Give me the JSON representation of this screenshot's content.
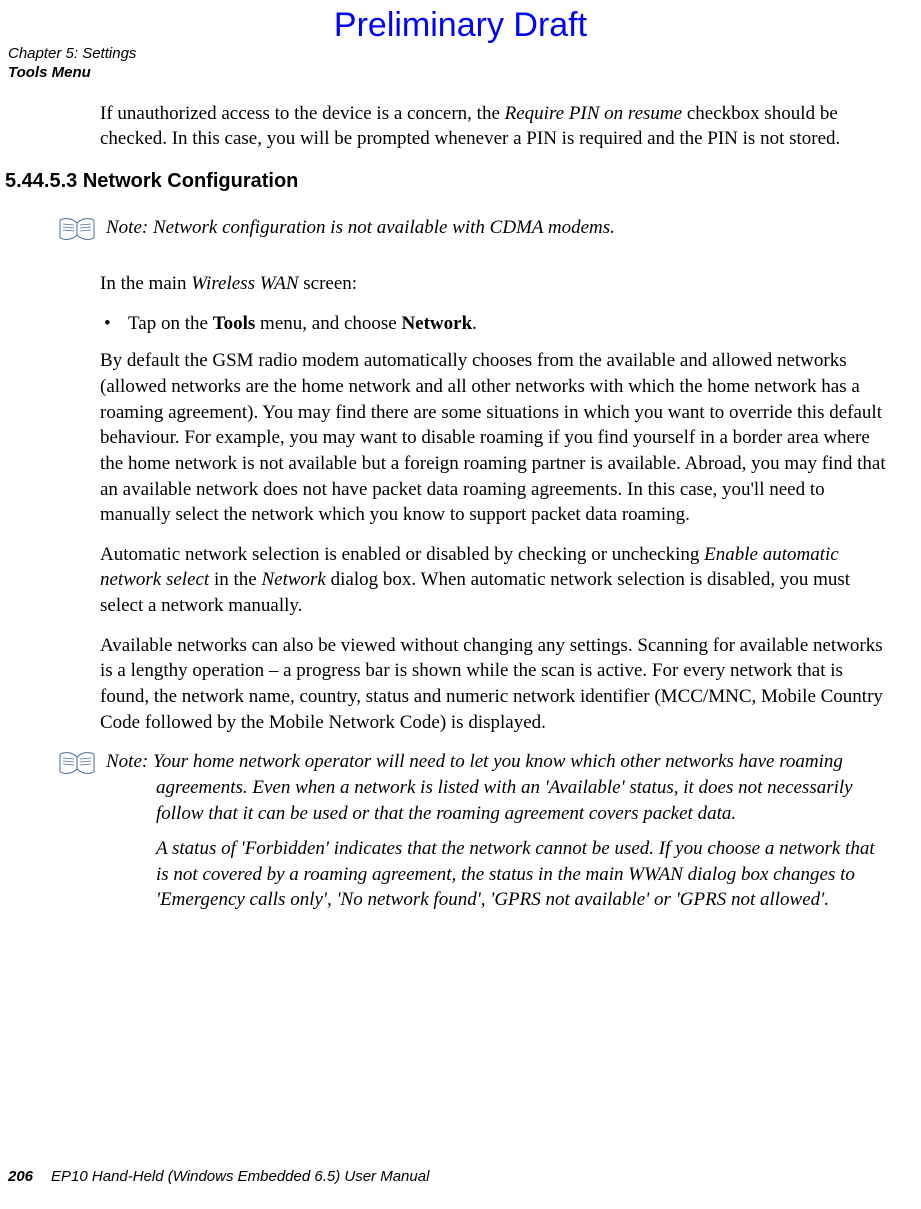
{
  "header": {
    "draft_banner": "Preliminary Draft",
    "chapter_line": "Chapter 5: Settings",
    "chapter_sub": "Tools Menu"
  },
  "body": {
    "intro_pre": "If unauthorized access to the device is a concern, the ",
    "intro_italic": "Require PIN on resume",
    "intro_post": " checkbox should be checked. In this case, you will be prompted whenever a PIN is required and the PIN is not stored.",
    "section_number": "5.44.5.3 ",
    "section_title": "Network Configuration",
    "note1": "Note: Network configuration is not available with CDMA modems.",
    "p2_pre": "In the main ",
    "p2_italic": "Wireless WAN",
    "p2_post": " screen:",
    "bullet_pre": "Tap on the ",
    "bullet_bold1": "Tools",
    "bullet_mid": " menu, and choose ",
    "bullet_bold2": "Network",
    "bullet_post": ".",
    "p3": "By default the GSM radio modem automatically chooses from the available and allowed networks (allowed networks are the home network and all other networks with which the home network has a roaming agreement). You may find there are some situations in which you want to override this default behaviour. For example, you may want to disable roaming if you find yourself in a border area where the home network is not available but a foreign roaming partner is available. Abroad, you may find that an available network does not have packet data roaming agreements. In this case, you'll need to manually select the network which you know to support packet data roaming.",
    "p4_pre": "Automatic network selection is enabled or disabled by checking or unchecking ",
    "p4_it1": "Enable automatic network select",
    "p4_mid": " in the ",
    "p4_it2": "Network",
    "p4_post": " dialog box. When automatic network selection is disabled, you must select a network manually.",
    "p5": "Available networks can also be viewed without changing any settings. Scanning for available networks is a lengthy operation – a progress bar is shown while the scan is active. For every network that is found, the network name, country, status and numeric network identifier (MCC/MNC, Mobile Country Code followed by the Mobile Network Code) is displayed.",
    "note2_p1": "Note: Your home network operator will need to let you know which other networks have roaming agreements. Even when a network is listed with an 'Available' status, it does not necessarily follow that it can be used or that the roaming agreement covers packet data.",
    "note2_p2": "A status of 'Forbidden' indicates that the network cannot be used. If you choose a network that is not covered by a roaming agreement, the status in the main WWAN dialog box changes to 'Emergency calls only', 'No network found', 'GPRS not available' or 'GPRS not allowed'."
  },
  "footer": {
    "page_number": "206",
    "manual_title": "EP10 Hand-Held (Windows Embedded 6.5) User Manual"
  }
}
